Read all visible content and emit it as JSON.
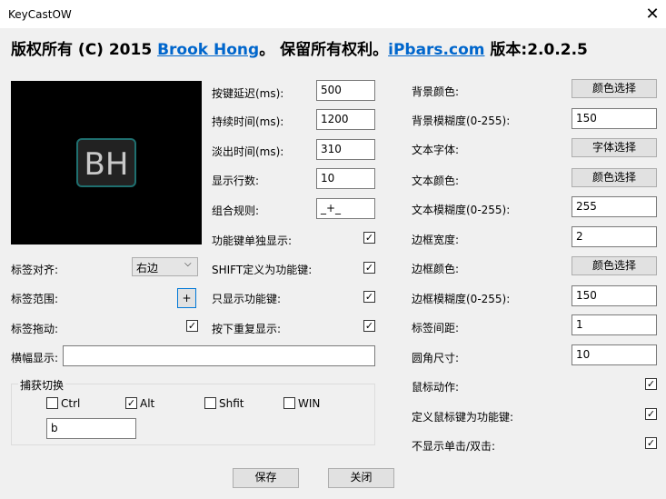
{
  "window": {
    "title": "KeyCastOW",
    "close_glyph": "✕"
  },
  "header": {
    "prefix": "版权所有 (C) 2015 ",
    "author_link": "Brook Hong",
    "middle": "。 保留所有权利。",
    "site_link": "iPbars.com",
    "version": " 版本:2.0.2.5"
  },
  "preview": {
    "logo_text": "BH"
  },
  "left": {
    "label_align": "标签对齐:",
    "label_align_value": "右边",
    "label_range": "标签范围:",
    "label_range_btn": "+",
    "label_drag": "标签拖动:",
    "label_drag_checked": true,
    "banner": "横幅显示:",
    "banner_value": ""
  },
  "middle": {
    "key_delay": "按键延迟(ms):",
    "key_delay_value": "500",
    "duration": "持续时间(ms):",
    "duration_value": "1200",
    "fade": "淡出时间(ms):",
    "fade_value": "310",
    "lines": "显示行数:",
    "lines_value": "10",
    "combo": "组合规则:",
    "combo_value": "_+_",
    "func_single": "功能键单独显示:",
    "shift_func": "SHIFT定义为功能键:",
    "only_func": "只显示功能键:",
    "repeat": "按下重复显示:"
  },
  "right": {
    "bg_color": "背景颜色:",
    "bg_color_btn": "颜色选择",
    "bg_blur": "背景模糊度(0-255):",
    "bg_blur_value": "150",
    "text_font": "文本字体:",
    "text_font_btn": "字体选择",
    "text_color": "文本颜色:",
    "text_color_btn": "颜色选择",
    "text_blur": "文本模糊度(0-255):",
    "text_blur_value": "255",
    "border_width": "边框宽度:",
    "border_width_value": "2",
    "border_color": "边框颜色:",
    "border_color_btn": "颜色选择",
    "border_blur": "边框模糊度(0-255):",
    "border_blur_value": "150",
    "label_spacing": "标签间距:",
    "label_spacing_value": "1",
    "corner": "圆角尺寸:",
    "corner_value": "10",
    "mouse_action": "鼠标动作:",
    "mouse_as_func": "定义鼠标键为功能键:",
    "no_click": "不显示单击/双击:"
  },
  "capture": {
    "title": "捕获切换",
    "ctrl": "Ctrl",
    "alt": "Alt",
    "shift": "Shfit",
    "win": "WIN",
    "key_value": "b"
  },
  "footer": {
    "save": "保存",
    "close": "关闭"
  },
  "check_glyph": "✓"
}
